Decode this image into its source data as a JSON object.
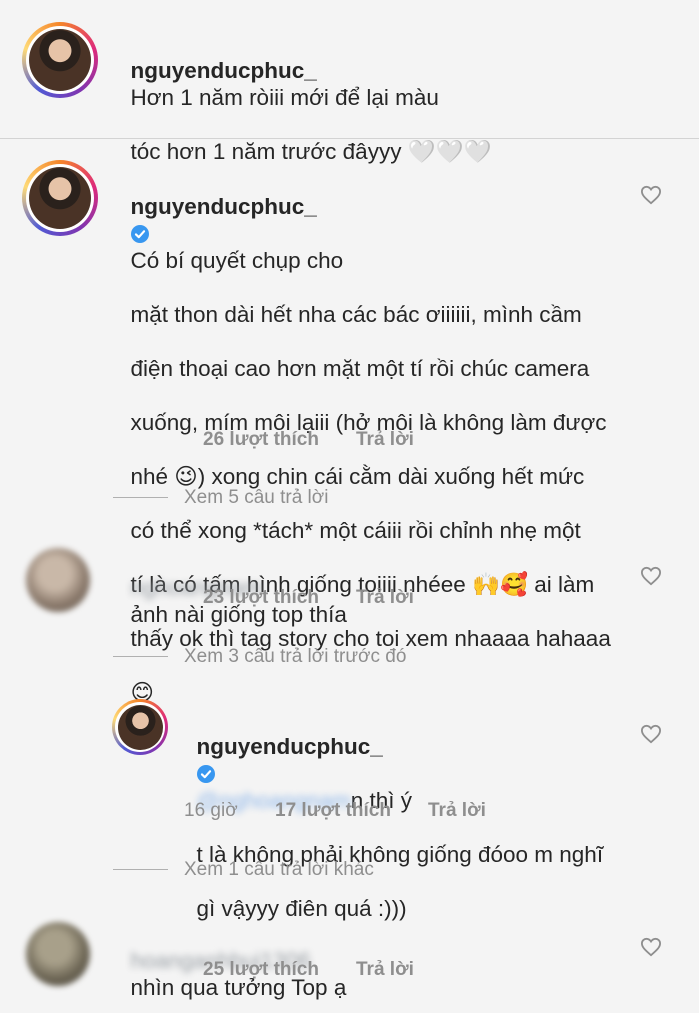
{
  "caption": {
    "username": "nguyenducphuc_",
    "text": "Hơn 1 năm ròiii mới để lại màu",
    "text2": "tóc hơn 1 năm trước đâyyy 🤍🤍🤍"
  },
  "comments": [
    {
      "username": "nguyenducphuc_",
      "lines": [
        "Có bí quyết chụp cho",
        "mặt thon dài hết nha các bác ơiiiiii, mình cầm",
        "điện thoại cao hơn mặt một tí rồi chúc camera",
        "xuống, mím môi lạiii (hở môi là không làm được",
        "nhé 😉) xong chin cái cằm dài xuống hết mức",
        "có thể xong *tách* một cáiii rồi chỉnh nhẹ một",
        "tí là có tấm hình giống toiiii nhéee 🙌🥰 ai làm",
        "thấy ok thì tag story cho toi xem nhaaaa hahaaa",
        "😊"
      ],
      "likes": "26 lượt thích",
      "reply": "Trả lời",
      "view_replies": "Xem 5 câu trả lời"
    },
    {
      "username_blurred": "nghoangnam",
      "text": "ảnh nài giống top thía",
      "likes": "23 lượt thích",
      "reply": "Trả lời",
      "view_prev": "Xem 3 câu trả lời trước đó"
    },
    {
      "username": "nguyenducphuc_",
      "mention_blurred": "@nghoangnam",
      "line1_rest": "n thì ý",
      "line2": "t là không phải không giống đóoo m nghĩ",
      "line3": "gì vậyyy điên quá :)))",
      "time": "16 giờ",
      "likes": "17 lượt thích",
      "reply": "Trả lời",
      "view_more": "Xem 1 câu trả lời khác"
    },
    {
      "username_blurred": "hoanganhbui1306",
      "username_tail": "...",
      "text": "nhìn qua tưởng Top ạ",
      "likes": "25 lượt thích",
      "reply": "Trả lời"
    }
  ],
  "colors": {
    "verified": "#3897f0",
    "meta": "#8e8e8e",
    "text": "#262626"
  }
}
